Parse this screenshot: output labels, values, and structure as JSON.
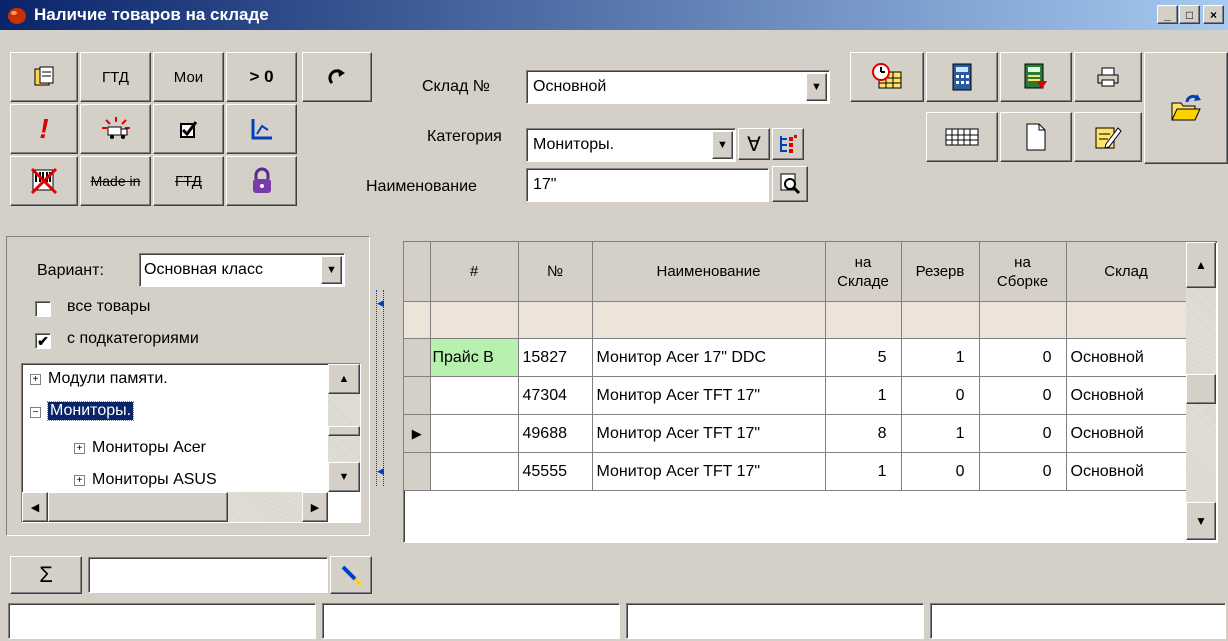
{
  "window": {
    "title": "Наличие товаров на складе",
    "controls": [
      "_",
      "□",
      "×"
    ]
  },
  "toolbar": {
    "gtd": "ГТД",
    "mine": "Мои",
    "gt_zero": "> 0",
    "made_in": "Made in",
    "gtd_strike": "ГТД",
    "exclamation": "!"
  },
  "filters": {
    "warehouse_label": "Склад №",
    "warehouse_value": "Основной",
    "category_label": "Категория",
    "category_value": "Мониторы.",
    "forall_symbol": "∀",
    "name_label": "Наименование",
    "name_value": "17\""
  },
  "left_panel": {
    "variant_label": "Вариант:",
    "variant_value": "Основная класс",
    "all_goods_label": "все товары",
    "all_goods_checked": false,
    "subcategories_label": "с подкатегориями",
    "subcategories_checked": true,
    "tree": [
      {
        "label": "Модули памяти.",
        "expander": "+",
        "level": 0,
        "selected": false
      },
      {
        "label": "Мониторы.",
        "expander": "−",
        "level": 0,
        "selected": true
      },
      {
        "label": "Мониторы Acer",
        "expander": "+",
        "level": 1,
        "selected": false
      },
      {
        "label": "Мониторы ASUS",
        "expander": "+",
        "level": 1,
        "selected": false
      }
    ]
  },
  "sum": {
    "symbol": "Σ",
    "value": ""
  },
  "grid": {
    "headers": {
      "hash": "#",
      "num": "№",
      "name": "Наименование",
      "stock_1": "на",
      "stock_2": "Складе",
      "reserve": "Резерв",
      "assembly_1": "на",
      "assembly_2": "Сборке",
      "warehouse": "Склад"
    },
    "rows": [
      {
        "hash": "Прайс В",
        "num": "15827",
        "name": "Монитор Acer 17\" DDC",
        "stock": "5",
        "reserve": "1",
        "assembly": "0",
        "warehouse": "Основной",
        "current": false
      },
      {
        "hash": "",
        "num": "47304",
        "name": "Монитор Acer TFT 17\"",
        "stock": "1",
        "reserve": "0",
        "assembly": "0",
        "warehouse": "Основной",
        "current": false
      },
      {
        "hash": "",
        "num": "49688",
        "name": "Монитор Acer TFT 17\"",
        "stock": "8",
        "reserve": "1",
        "assembly": "0",
        "warehouse": "Основной",
        "current": true
      },
      {
        "hash": "",
        "num": "45555",
        "name": "Монитор Acer TFT 17\"",
        "stock": "1",
        "reserve": "0",
        "assembly": "0",
        "warehouse": "Основной",
        "current": false
      }
    ],
    "price_cell_color": "#b8f0b0"
  },
  "colors": {
    "titlebar_start": "#0a246a",
    "titlebar_end": "#a6caf0",
    "selection": "#0a246a",
    "face": "#d4d0c8"
  },
  "status_bar": [
    "",
    "",
    "",
    ""
  ]
}
